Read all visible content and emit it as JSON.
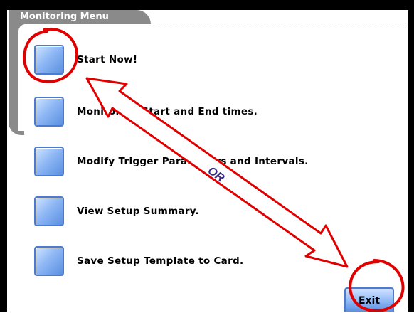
{
  "menu": {
    "title": "Monitoring Menu",
    "items": [
      {
        "label": "Start Now!"
      },
      {
        "label": "Monitoring Start and End times."
      },
      {
        "label": "Modify Trigger Parameters and Intervals."
      },
      {
        "label": "View Setup Summary."
      },
      {
        "label": "Save Setup Template to Card."
      }
    ]
  },
  "exit_label": "Exit",
  "annotation": {
    "arrow_text": "OR",
    "color": "#ff0000"
  }
}
